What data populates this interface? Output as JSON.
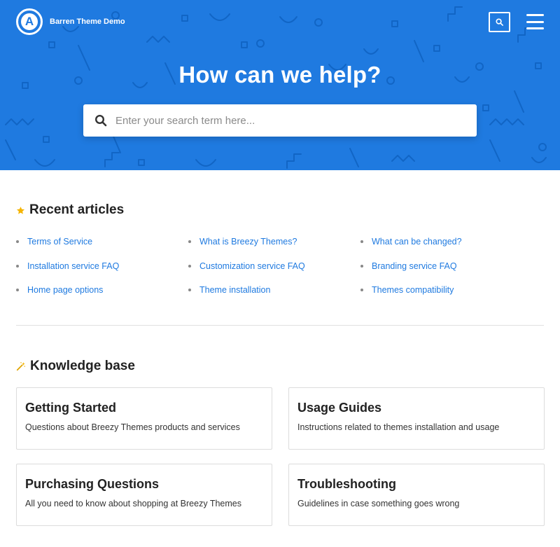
{
  "header": {
    "site_name": "Barren Theme Demo",
    "logo_letter": "A",
    "search_icon": "search-icon",
    "menu_icon": "hamburger-menu-icon"
  },
  "hero": {
    "title": "How can we help?",
    "search_placeholder": "Enter your search term here...",
    "search_value": "",
    "background_color": "#1f7ae0"
  },
  "recent": {
    "icon": "star-icon",
    "title": "Recent articles",
    "articles": [
      "Terms of Service",
      "What is Breezy Themes?",
      "What can be changed?",
      "Installation service FAQ",
      "Customization service FAQ",
      "Branding service FAQ",
      "Home page options",
      "Theme installation",
      "Themes compatibility"
    ]
  },
  "knowledge_base": {
    "icon": "magic-wand-icon",
    "title": "Knowledge base",
    "categories": [
      {
        "title": "Getting Started",
        "description": "Questions about Breezy Themes products and services"
      },
      {
        "title": "Usage Guides",
        "description": "Instructions related to themes installation and usage"
      },
      {
        "title": "Purchasing Questions",
        "description": "All you need to know about shopping at Breezy Themes"
      },
      {
        "title": "Troubleshooting",
        "description": "Guidelines in case something goes wrong"
      }
    ]
  },
  "colors": {
    "accent": "#1f7ae0",
    "star": "#f5b400"
  }
}
